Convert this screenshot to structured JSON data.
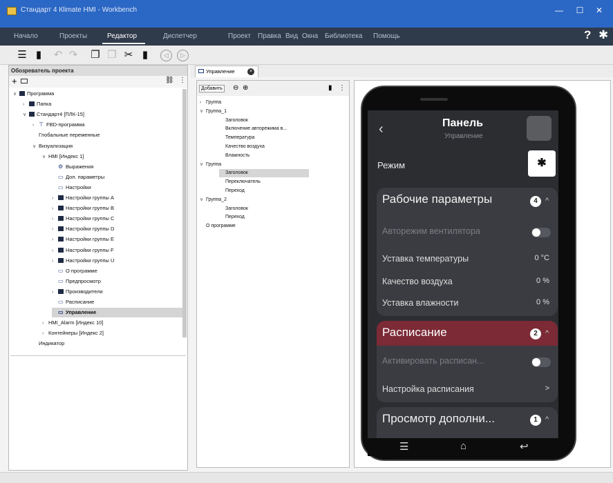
{
  "window": {
    "title": "Стандарт 4 Кlimate HMI - Workbench"
  },
  "menu": {
    "items": [
      "Начало",
      "Проекты",
      "Редактор",
      "Диспетчер",
      "Проект",
      "Правка",
      "Вид",
      "Окна",
      "Библиотека",
      "Помощь"
    ],
    "active": "Редактор"
  },
  "left_panel": {
    "title": "Обозреватель проекта",
    "tree": [
      {
        "label": "Программа",
        "level": 0,
        "arrow": "down",
        "icon": "folder"
      },
      {
        "label": "Папка",
        "level": 1,
        "arrow": "right",
        "icon": "folder"
      },
      {
        "label": "Стандарт4 [ПЛК-15]",
        "level": 1,
        "arrow": "down",
        "icon": "device"
      },
      {
        "label": "FBD-программа",
        "level": 2,
        "arrow": "right",
        "icon": "fbd"
      },
      {
        "label": "Глобальные переменные",
        "level": 2,
        "arrow": "",
        "icon": ""
      },
      {
        "label": "Визуализация",
        "level": 2,
        "arrow": "down",
        "icon": ""
      },
      {
        "label": "HMI [Индекс 1]",
        "level": 3,
        "arrow": "down",
        "icon": ""
      },
      {
        "label": "Выражения",
        "level": 4,
        "arrow": "",
        "icon": "gear"
      },
      {
        "label": "Доп. параметры",
        "level": 4,
        "arrow": "",
        "icon": "screen"
      },
      {
        "label": "Настройки",
        "level": 4,
        "arrow": "",
        "icon": "screen"
      },
      {
        "label": "Настройки группы A",
        "level": 4,
        "arrow": "right",
        "icon": "folder"
      },
      {
        "label": "Настройки группы B",
        "level": 4,
        "arrow": "right",
        "icon": "folder"
      },
      {
        "label": "Настройки группы C",
        "level": 4,
        "arrow": "right",
        "icon": "folder"
      },
      {
        "label": "Настройки группы D",
        "level": 4,
        "arrow": "right",
        "icon": "folder"
      },
      {
        "label": "Настройки группы E",
        "level": 4,
        "arrow": "right",
        "icon": "folder"
      },
      {
        "label": "Настройки группы F",
        "level": 4,
        "arrow": "right",
        "icon": "folder"
      },
      {
        "label": "Настройки группы U",
        "level": 4,
        "arrow": "right",
        "icon": "folder"
      },
      {
        "label": "О программе",
        "level": 4,
        "arrow": "",
        "icon": "screen"
      },
      {
        "label": "Предпросмотр",
        "level": 4,
        "arrow": "",
        "icon": "screen"
      },
      {
        "label": "Производители",
        "level": 4,
        "arrow": "right",
        "icon": "folder"
      },
      {
        "label": "Расписание",
        "level": 4,
        "arrow": "",
        "icon": "screen"
      },
      {
        "label": "Управление",
        "level": 4,
        "arrow": "",
        "icon": "screen",
        "selected": true
      },
      {
        "label": "HMI_Alarm [Индекс 10]",
        "level": 3,
        "arrow": "right",
        "icon": ""
      },
      {
        "label": "Контейнеры [Индекс 2]",
        "level": 3,
        "arrow": "right",
        "icon": ""
      },
      {
        "label": "Индикатор",
        "level": 2,
        "arrow": "",
        "icon": ""
      }
    ]
  },
  "editor_tab": {
    "label": "Управление"
  },
  "middle_panel": {
    "add_label": "Добавить",
    "rows": [
      {
        "label": "Группа",
        "level": 0,
        "arrow": "right"
      },
      {
        "label": "Группа_1",
        "level": 0,
        "arrow": "down"
      },
      {
        "label": "Заголовок",
        "level": 1,
        "arrow": ""
      },
      {
        "label": "Включение авторежима в...",
        "level": 1,
        "arrow": ""
      },
      {
        "label": "Температура",
        "level": 1,
        "arrow": ""
      },
      {
        "label": "Качество воздуха",
        "level": 1,
        "arrow": ""
      },
      {
        "label": "Влажность",
        "level": 1,
        "arrow": ""
      },
      {
        "label": "Группа",
        "level": 0,
        "arrow": "down"
      },
      {
        "label": "Заголовок",
        "level": 1,
        "arrow": "",
        "selected": true
      },
      {
        "label": "Переключатель",
        "level": 1,
        "arrow": ""
      },
      {
        "label": "Переход",
        "level": 1,
        "arrow": ""
      },
      {
        "label": "Группа_2",
        "level": 0,
        "arrow": "down"
      },
      {
        "label": "Заголовок",
        "level": 1,
        "arrow": ""
      },
      {
        "label": "Переход",
        "level": 1,
        "arrow": ""
      },
      {
        "label": "О программе",
        "level": 0,
        "arrow": ""
      }
    ]
  },
  "phone": {
    "header_title": "Панель",
    "header_subtitle": "Управление",
    "mode_label": "Режим",
    "mode_icon": "fan-icon",
    "cards": {
      "work": {
        "title": "Рабочие параметры",
        "badge": "4",
        "rows": [
          {
            "label": "Авторежим вентилятора",
            "value": "",
            "toggle": true,
            "disabled": true
          },
          {
            "label": "Уставка температуры",
            "value": "0 °C"
          },
          {
            "label": "Качество воздуха",
            "value": "0 %"
          },
          {
            "label": "Уставка влажности",
            "value": "0 %"
          }
        ]
      },
      "schedule": {
        "title": "Расписание",
        "badge": "2",
        "rows": [
          {
            "label": "Активировать расписан...",
            "toggle": true,
            "disabled": true
          },
          {
            "label": "Настройка расписания",
            "value": ">"
          }
        ]
      },
      "extra": {
        "title": "Просмотр дополни...",
        "badge": "1"
      }
    }
  },
  "colors": {
    "menubar": "#2f3a4a",
    "titlebar": "#2b67c4",
    "accent_schedule": "#7b2a36",
    "card": "#3a3c41"
  }
}
